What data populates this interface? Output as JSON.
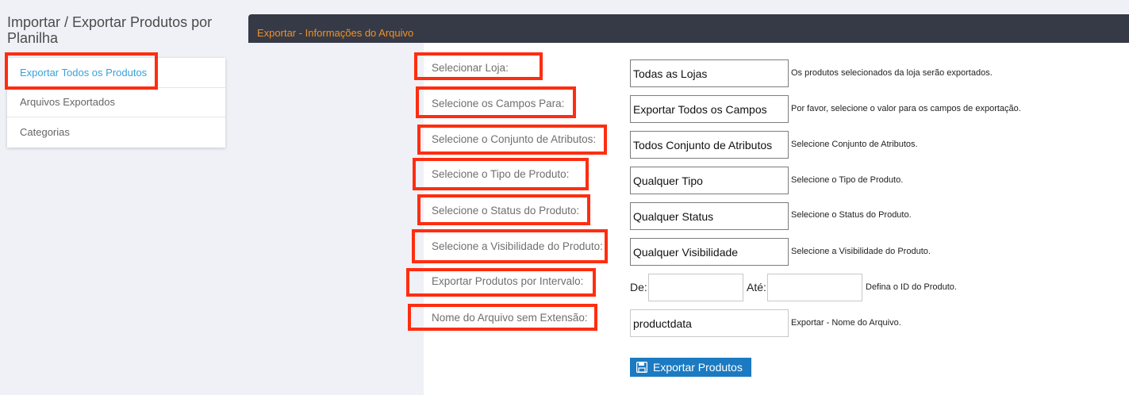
{
  "page": {
    "title": "Importar / Exportar Produtos por Planilha"
  },
  "sidebar": {
    "items": [
      {
        "label": "Exportar Todos os Produtos",
        "active": true
      },
      {
        "label": "Arquivos Exportados",
        "active": false
      },
      {
        "label": "Categorias",
        "active": false
      }
    ]
  },
  "panel": {
    "title": "Exportar - Informações do Arquivo"
  },
  "form": {
    "store": {
      "label": "Selecionar Loja:",
      "value": "Todas as Lojas",
      "hint": "Os produtos selecionados da loja serão exportados."
    },
    "fields": {
      "label": "Selecione os Campos Para:",
      "value": "Exportar Todos os Campos",
      "hint": "Por favor, selecione o valor para os campos de exportação."
    },
    "attribute_set": {
      "label": "Selecione o Conjunto de Atributos:",
      "value": "Todos Conjunto de Atributos",
      "hint": "Selecione Conjunto de Atributos."
    },
    "product_type": {
      "label": "Selecione o Tipo de Produto:",
      "value": "Qualquer Tipo",
      "hint": "Selecione o Tipo de Produto."
    },
    "product_status": {
      "label": "Selecione o Status do Produto:",
      "value": "Qualquer Status",
      "hint": "Selecione o Status do Produto."
    },
    "visibility": {
      "label": "Selecione a Visibilidade do Produto:",
      "value": "Qualquer Visibilidade",
      "hint": "Selecione a Visibilidade do Produto."
    },
    "range": {
      "label": "Exportar Produtos por Intervalo:",
      "from_label": "De:",
      "from_value": "",
      "to_label": "Até:",
      "to_value": "",
      "hint": "Defina o ID do Produto."
    },
    "filename": {
      "label": "Nome do Arquivo sem Extensão:",
      "value": "productdata",
      "hint": "Exportar - Nome do Arquivo."
    },
    "submit_label": "Exportar Produtos"
  },
  "colors": {
    "highlight": "#ff2d10",
    "header_bg": "#363a46",
    "header_text": "#f29023",
    "active_link": "#3aa0d8",
    "button_bg": "#1b7ac2"
  }
}
